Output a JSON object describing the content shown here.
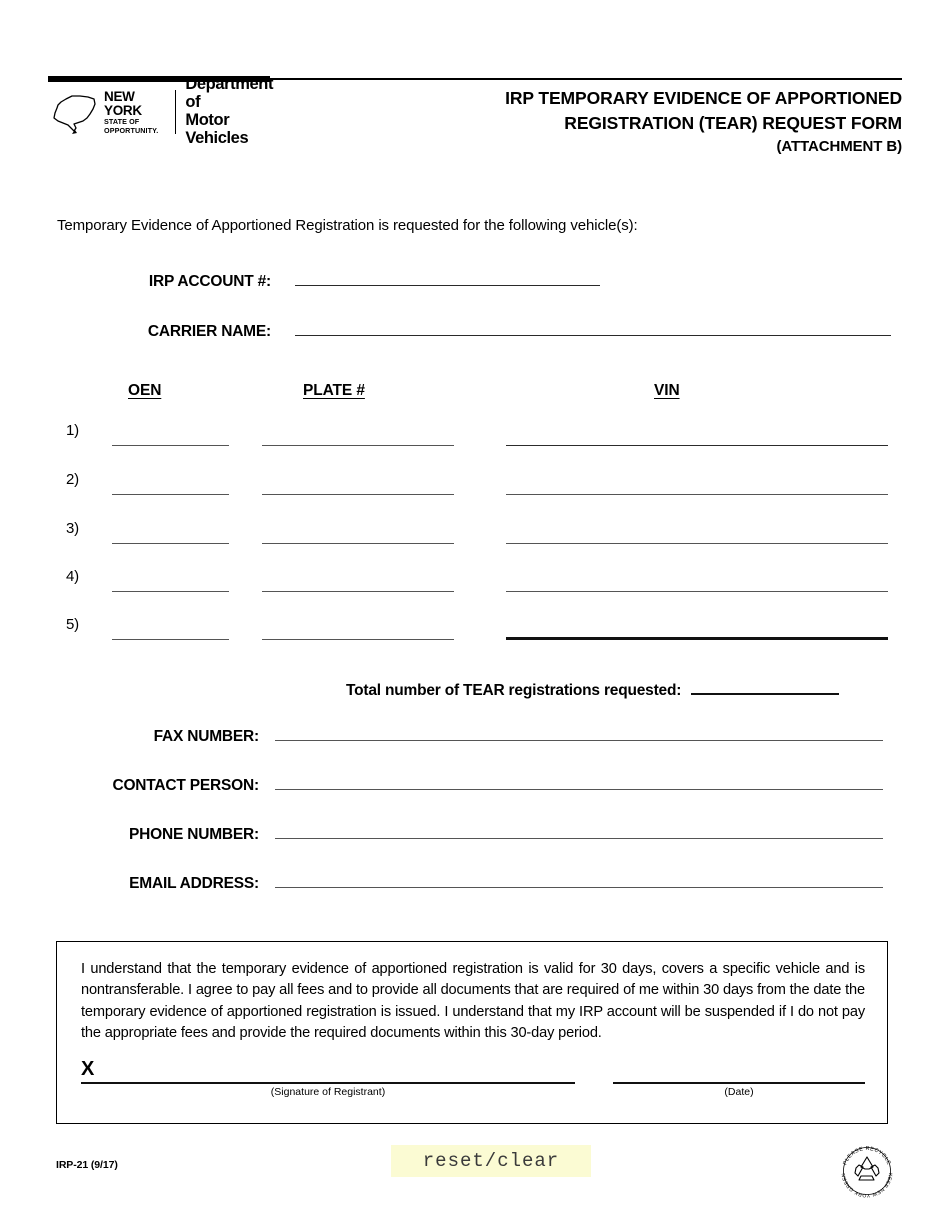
{
  "header": {
    "logo": {
      "state_line1": "NEW YORK",
      "state_line2": "STATE OF",
      "state_line3": "OPPORTUNITY.",
      "agency_line1": "Department of",
      "agency_line2": "Motor Vehicles"
    },
    "title_line1": "IRP TEMPORARY EVIDENCE OF APPORTIONED",
    "title_line2": "REGISTRATION (TEAR) REQUEST FORM",
    "title_line3": "(ATTACHMENT B)"
  },
  "intro": "Temporary Evidence of Apportioned Registration is requested for the following vehicle(s):",
  "account": {
    "irp_account_label": "IRP ACCOUNT #:",
    "irp_account_value": "",
    "carrier_name_label": "CARRIER NAME:",
    "carrier_name_value": ""
  },
  "vehicle_table": {
    "columns": [
      "OEN",
      "PLATE #",
      "VIN"
    ],
    "rows": [
      {
        "number": "1)",
        "oen": "",
        "plate": "",
        "vin": ""
      },
      {
        "number": "2)",
        "oen": "",
        "plate": "",
        "vin": ""
      },
      {
        "number": "3)",
        "oen": "",
        "plate": "",
        "vin": ""
      },
      {
        "number": "4)",
        "oen": "",
        "plate": "",
        "vin": ""
      },
      {
        "number": "5)",
        "oen": "",
        "plate": "",
        "vin": ""
      }
    ]
  },
  "total": {
    "label": "Total number of TEAR registrations requested:",
    "value": ""
  },
  "contact": {
    "fax_label": "FAX NUMBER:",
    "fax_value": "",
    "person_label": "CONTACT PERSON:",
    "person_value": "",
    "phone_label": "PHONE NUMBER:",
    "phone_value": "",
    "email_label": "EMAIL ADDRESS:",
    "email_value": ""
  },
  "attestation": {
    "text": "I understand that the temporary evidence of apportioned registration is valid for 30 days, covers a specific vehicle and is nontransferable. I agree to pay all fees and to provide all documents that are required of me within 30 days from the date the temporary evidence of apportioned registration is issued. I understand that my IRP account will be suspended if I do not pay the appropriate fees and provide the required documents within this 30-day period.",
    "signature_mark": "X",
    "signature_caption": "(Signature of Registrant)",
    "date_caption": "(Date)",
    "signature_value": "",
    "date_value": ""
  },
  "footer": {
    "form_code": "IRP-21 (9/17)",
    "reset_button": "reset/clear",
    "recycle_top_text": "PLEASE RECYCLE",
    "recycle_bottom_text": "KEEP NEW YORK GREEN"
  },
  "colors": {
    "ink": "#000000",
    "rule": "#555555",
    "button_fill": "#fbfbd3",
    "paper": "#ffffff"
  }
}
